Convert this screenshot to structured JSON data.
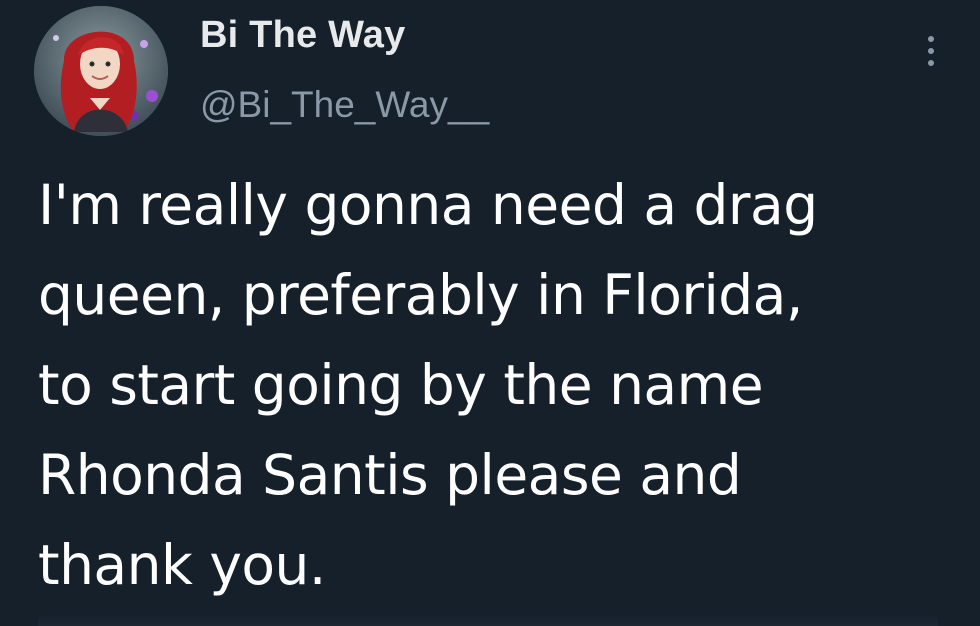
{
  "author": {
    "display_name": "Bi The Way",
    "handle": "@Bi_The_Way__",
    "avatar_icon": "profile-avatar-icon"
  },
  "menu": {
    "more_icon": "more-vertical-icon"
  },
  "tweet": {
    "text": "I'm really gonna need a drag\nqueen, preferably in Florida,\nto start going by the name\nRhonda Santis please and\nthank you."
  },
  "colors": {
    "background": "#15202b",
    "primary_text": "#e7e9ea",
    "secondary_text": "#8b98a5"
  }
}
